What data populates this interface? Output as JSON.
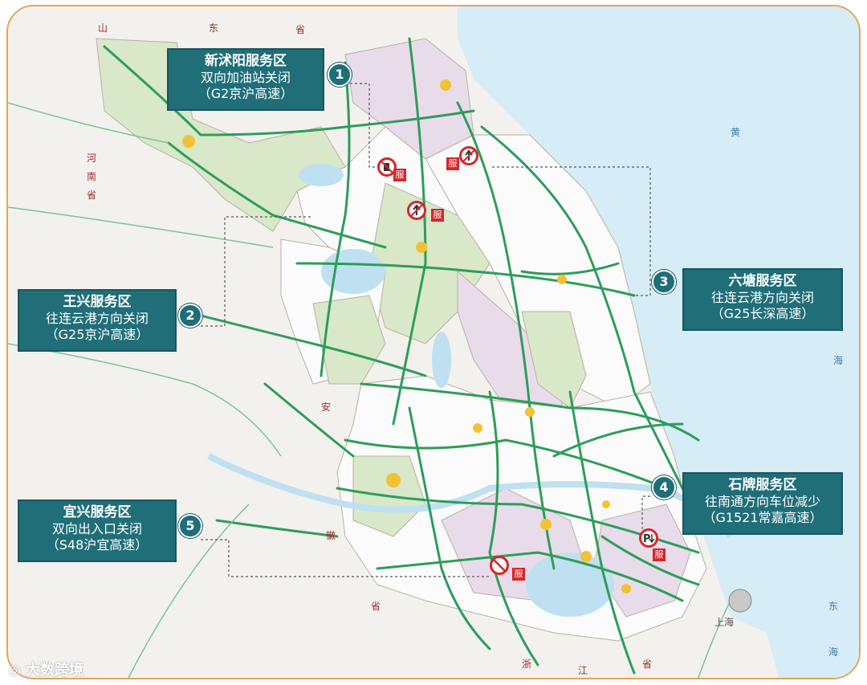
{
  "colors": {
    "sea": "#d6ecf6",
    "land": "#f3f1ee",
    "province_green": "#d9e8c8",
    "province_purple": "#e9dcea",
    "province_white": "#fbfbfb",
    "lake": "#bfe0f0",
    "expressway": "#2d9d5a",
    "callout_bg": "#1f6e78",
    "border_orange": "#e8a45a",
    "sign_red": "#d6262a"
  },
  "callouts": [
    {
      "number": "1",
      "title": "新沭阳服务区",
      "line2": "双向加油站关闭",
      "line3": "（G2京沪高速）"
    },
    {
      "number": "2",
      "title": "王兴服务区",
      "line2": "往连云港方向关闭",
      "line3": "（G25京沪高速）"
    },
    {
      "number": "3",
      "title": "六塘服务区",
      "line2": "往连云港方向关闭",
      "line3": "（G25长深高速）"
    },
    {
      "number": "4",
      "title": "石牌服务区",
      "line2": "往南通方向车位减少",
      "line3": "（G1521常嘉高速）"
    },
    {
      "number": "5",
      "title": "宜兴服务区",
      "line2": "双向出入口关闭",
      "line3": "（S48沪宜高速）"
    }
  ],
  "service_mark": "服",
  "map_labels": {
    "shandong": [
      "山",
      "东",
      "省"
    ],
    "henan": [
      "河",
      "南",
      "省"
    ],
    "anhui": [
      "安",
      "徽",
      "省"
    ],
    "zhejiang": [
      "浙",
      "江",
      "省"
    ],
    "yellow_sea": [
      "黄",
      "海"
    ],
    "east_sea": [
      "东",
      "海"
    ],
    "shanghai": "上海"
  },
  "watermark": "大数跨境",
  "icons": [
    "fuel-closed-icon",
    "no-entry-icon",
    "no-straight-icon",
    "parking-reduced-icon",
    "watermark-logo-icon"
  ]
}
